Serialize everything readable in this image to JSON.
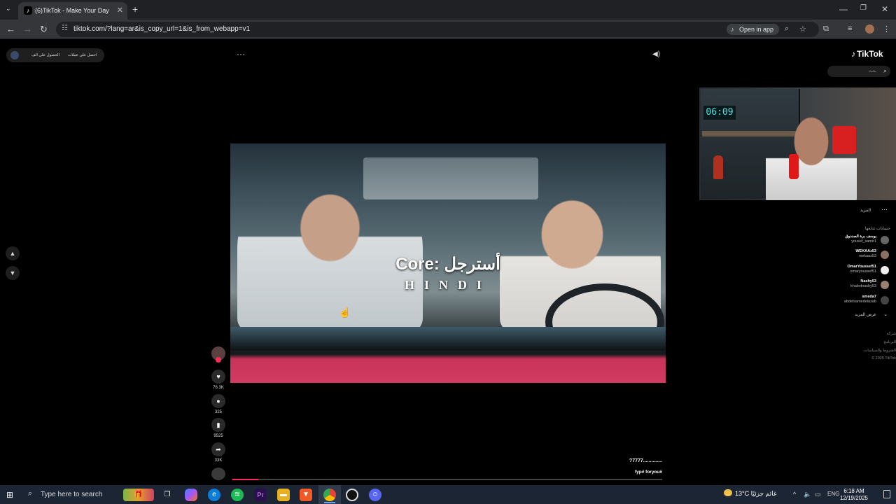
{
  "browser": {
    "tab_title": "(6)TikTok - Make Your Day",
    "url": "tiktok.com/?lang=ar&is_copy_url=1&is_from_webapp=v1",
    "open_in_app": "Open in app"
  },
  "page": {
    "top_pill": {
      "label_a": "الحصول على الف",
      "label_b": "احصل على عملات"
    },
    "video": {
      "overlay_title": "Core: أسترجل",
      "overlay_sub": "HINDI",
      "progress": 0.06
    },
    "actions": {
      "likes": "76.3K",
      "comments": "325",
      "saves": "9525",
      "shares": "33K"
    },
    "caption": {
      "line1": "?7777..............",
      "line2": "fyp# foryou#"
    }
  },
  "sidebar": {
    "logo": "TikTok",
    "search_placeholder": "بحث",
    "more": "المزيد",
    "following_title": "حسابات تتابعها",
    "accounts": [
      {
        "name": "يوسف برة الصندوق",
        "handle": "yousef_samir1"
      },
      {
        "name": "WEKAAz53",
        "handle": "wekaaz53"
      },
      {
        "name": "OmarYoussef51",
        "handle": "omaryoussef51"
      },
      {
        "name": "Nashy53",
        "handle": "khalednashy53"
      },
      {
        "name": "smeda7",
        "handle": "abdelsamedelazab"
      }
    ],
    "see_more": "عرض المزيد",
    "footer": [
      "شركة",
      "البرنامج",
      "الشروط والسياسات",
      "© 2025 TikTok"
    ]
  },
  "taskbar": {
    "search_placeholder": "Type here to search",
    "weather": "13°C  غائم جزئيًا",
    "lang": "ENG",
    "time": "6:18 AM",
    "date": "12/19/2025"
  }
}
